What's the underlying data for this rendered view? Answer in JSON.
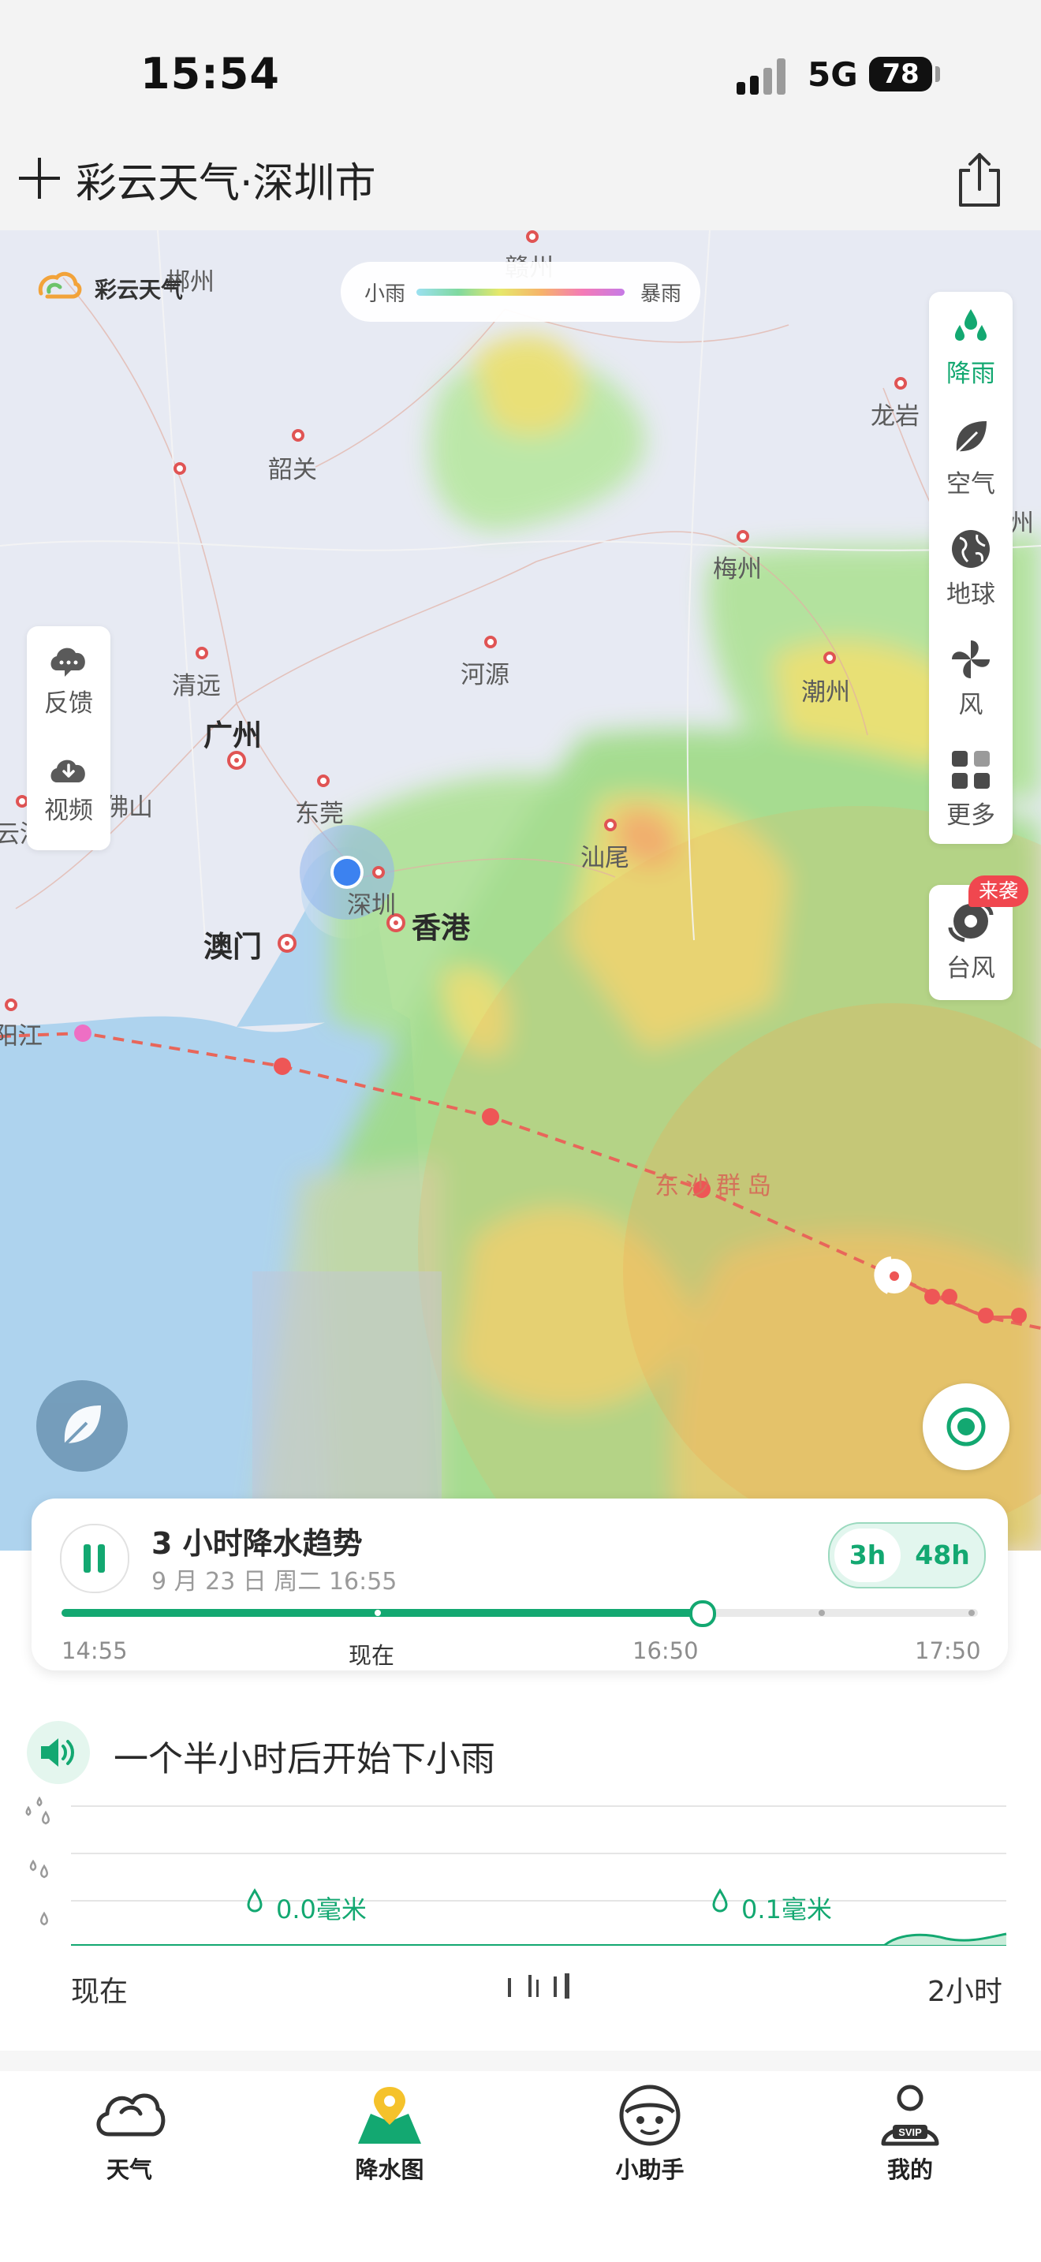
{
  "status_bar": {
    "time": "15:54",
    "network": "5G",
    "battery": "78"
  },
  "header": {
    "add_icon": "plus-icon",
    "title": "彩云天气·深圳市",
    "share_icon": "share-icon"
  },
  "map": {
    "brand": "彩云天气",
    "legend": {
      "min_label": "小雨",
      "max_label": "暴雨"
    },
    "cities": [
      {
        "name": "郴州",
        "kind": "normal"
      },
      {
        "name": "赣州",
        "kind": "normal"
      },
      {
        "name": "韶关",
        "kind": "normal"
      },
      {
        "name": "龙岩",
        "kind": "normal"
      },
      {
        "name": "梅州",
        "kind": "normal"
      },
      {
        "name": "清远",
        "kind": "normal"
      },
      {
        "name": "河源",
        "kind": "normal"
      },
      {
        "name": "潮州",
        "kind": "normal"
      },
      {
        "name": "广州",
        "kind": "big"
      },
      {
        "name": "东莞",
        "kind": "normal"
      },
      {
        "name": "汕尾",
        "kind": "normal"
      },
      {
        "name": "深圳",
        "kind": "normal"
      },
      {
        "name": "香港",
        "kind": "big"
      },
      {
        "name": "澳门",
        "kind": "big"
      },
      {
        "name": "东沙群岛",
        "kind": "island"
      },
      {
        "name": "阳江",
        "kind": "normal"
      },
      {
        "name": "云浮",
        "kind": "normal"
      },
      {
        "name": "佛山",
        "kind": "normal"
      },
      {
        "name": "州",
        "kind": "normal"
      }
    ],
    "left_tools": [
      {
        "label": "反馈",
        "icon": "cloud-chat-icon"
      },
      {
        "label": "视频",
        "icon": "cloud-download-icon"
      }
    ],
    "layers": [
      {
        "label": "降雨",
        "icon": "raindrops-icon",
        "active": true
      },
      {
        "label": "空气",
        "icon": "leaf-icon",
        "active": false
      },
      {
        "label": "地球",
        "icon": "globe-icon",
        "active": false
      },
      {
        "label": "风",
        "icon": "pinwheel-icon",
        "active": false
      },
      {
        "label": "更多",
        "icon": "grid-icon",
        "active": false
      }
    ],
    "typhoon": {
      "label": "台风",
      "badge": "来袭",
      "icon": "typhoon-icon"
    }
  },
  "playback": {
    "title": "3 小时降水趋势",
    "datetime": "9 月 23 日 周二 16:55",
    "range_options": [
      "3h",
      "48h"
    ],
    "selected_range": "3h",
    "progress_fraction": 0.7,
    "tick_labels": [
      "14:55",
      "现在",
      "16:50",
      "17:50"
    ]
  },
  "forecast": {
    "summary": "一个半小时后开始下小雨",
    "readings": [
      "0.0毫米",
      "0.1毫米"
    ],
    "x_start": "现在",
    "x_end": "2小时"
  },
  "bottom_nav": [
    {
      "label": "天气",
      "icon": "cloud-icon",
      "active": false
    },
    {
      "label": "降水图",
      "icon": "map-pin-icon",
      "active": true
    },
    {
      "label": "小助手",
      "icon": "assistant-icon",
      "active": false
    },
    {
      "label": "我的",
      "icon": "profile-svip-icon",
      "active": false
    }
  ],
  "colors": {
    "accent": "#13a871",
    "alert": "#f0474f",
    "typhoon_track": "#e8665a"
  }
}
